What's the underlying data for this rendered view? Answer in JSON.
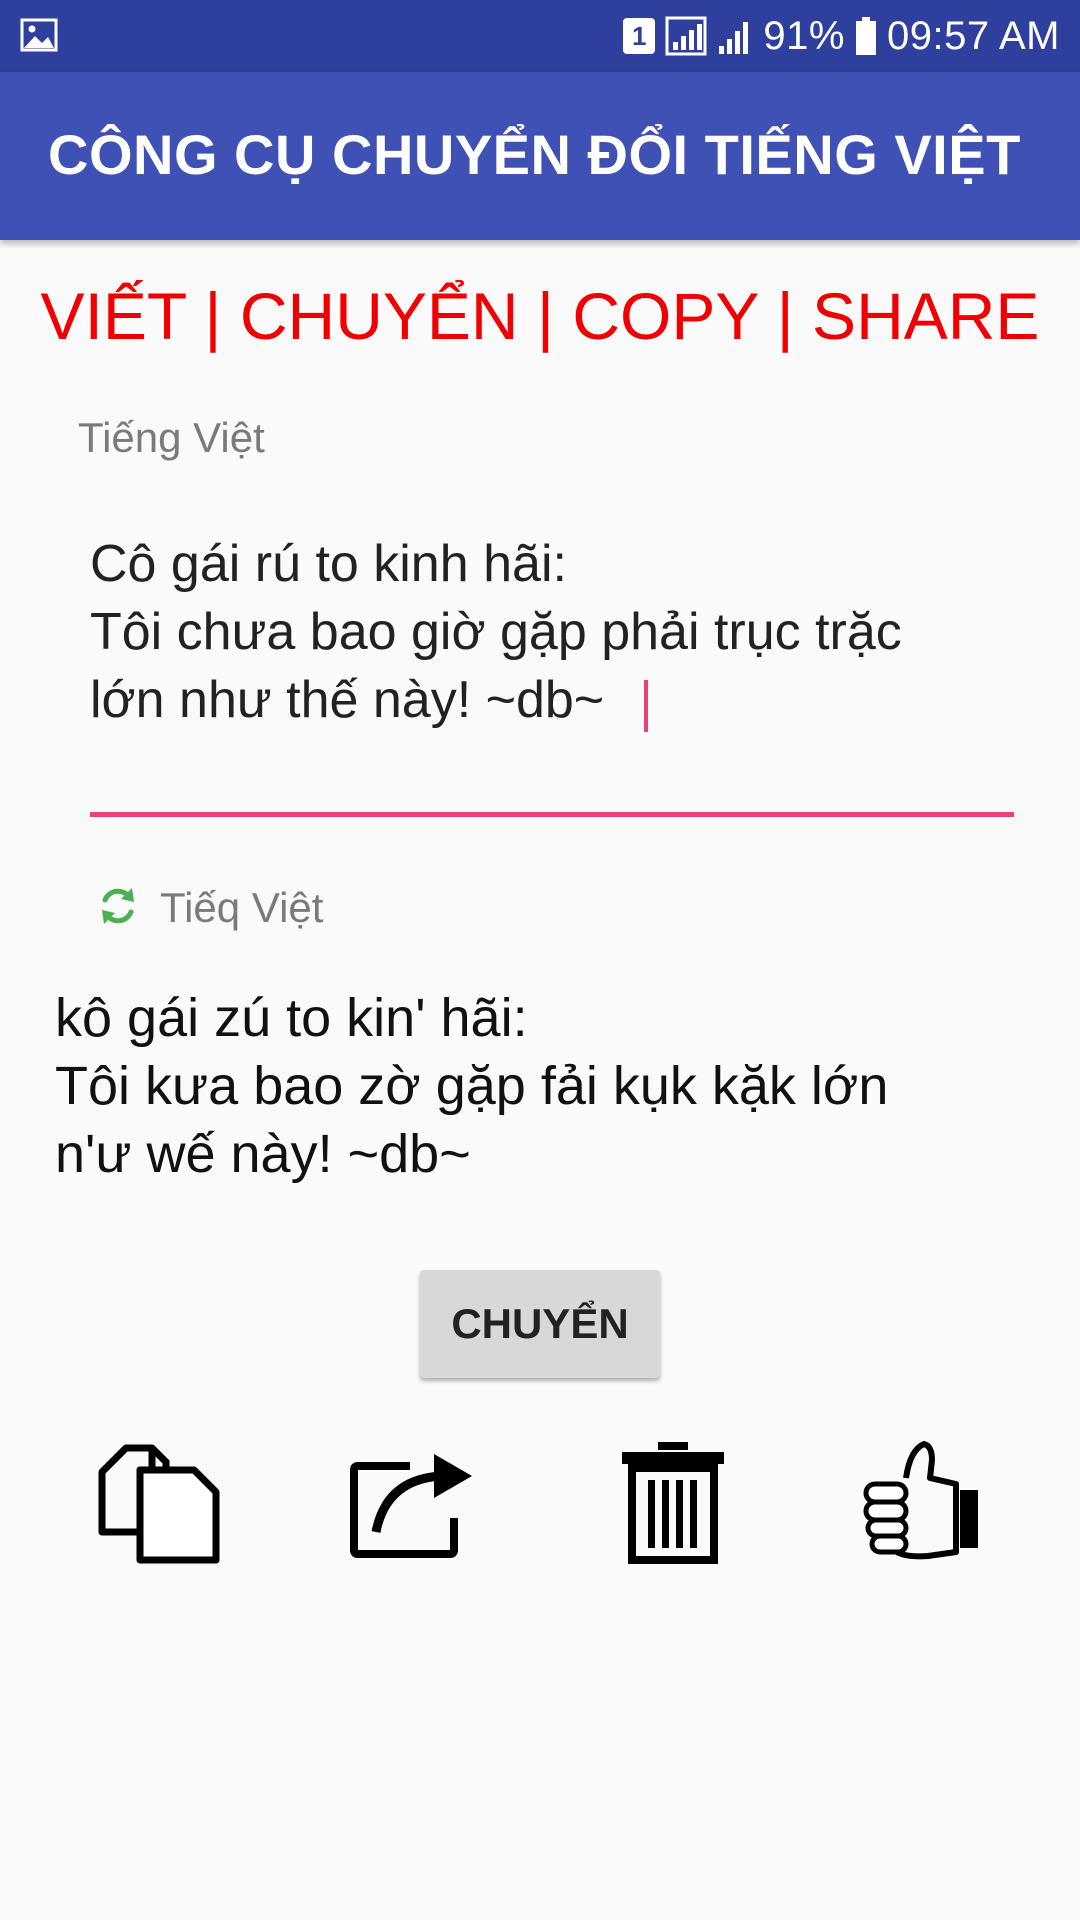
{
  "status_bar": {
    "sim_slot": "1",
    "battery_percent": "91%",
    "time": "09:57 AM"
  },
  "app_bar": {
    "title": "CÔNG CỤ CHUYỂN ĐỔI TIẾNG VIỆT"
  },
  "menu": {
    "text": "VIẾT | CHUYỂN | COPY | SHARE"
  },
  "input": {
    "label": "Tiếng Việt",
    "value": "Cô gái rú to kinh hãi:\nTôi chưa bao giờ gặp phải trục trặc\nlớn như thế này!    ~db~"
  },
  "output": {
    "label": "Tiếq Việt",
    "text": "kô gái zú to kin' hãi:\nTôi kưa bao zờ gặp fải kụk kặk lớn\nn'ư wế này!    ~db~"
  },
  "convert_button": {
    "label": "CHUYỂN"
  },
  "colors": {
    "status_bar": "#2f3f9e",
    "app_bar": "#3f51b5",
    "menu_text": "#f00000",
    "accent": "#ec407a",
    "refresh_icon": "#4caf50"
  },
  "icons": [
    "gallery-icon",
    "copy-icon",
    "share-icon",
    "trash-icon",
    "thumbs-up-icon",
    "refresh-icon"
  ]
}
